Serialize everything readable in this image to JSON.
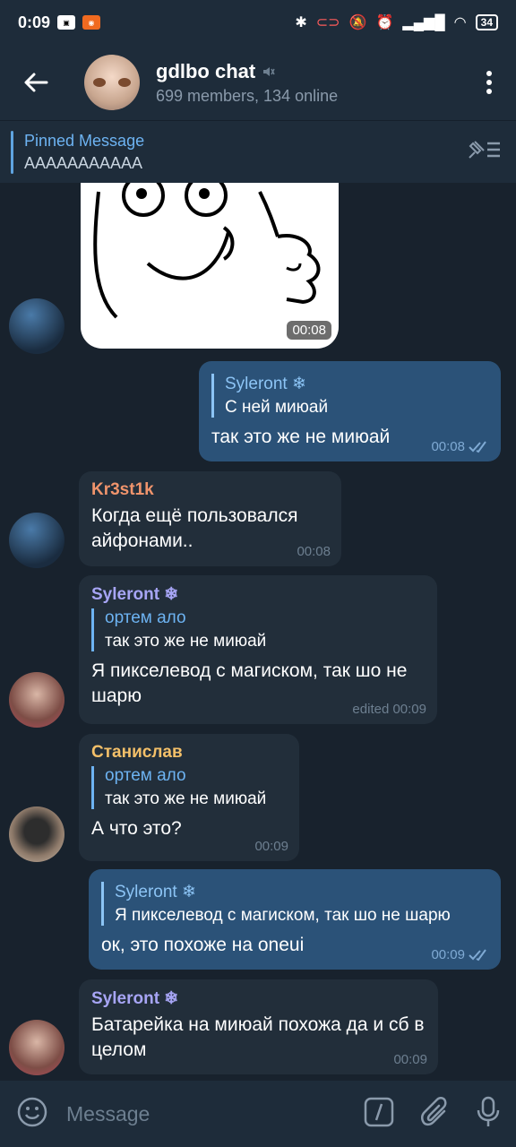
{
  "status": {
    "time": "0:09",
    "battery": "34"
  },
  "header": {
    "title": "gdlbo chat",
    "subtitle": "699 members, 134 online"
  },
  "pinned": {
    "title": "Pinned Message",
    "text": "AAAAAAAAAAA"
  },
  "messages": {
    "sticker_time": "00:08",
    "m1": {
      "reply_name": "Syleront ❄",
      "reply_text": "С ней миюай",
      "text": "так это же не миюай",
      "time": "00:08"
    },
    "m2": {
      "sender": "Kr3st1k",
      "text": "Когда ещё пользовался айфонами..",
      "time": "00:08"
    },
    "m3": {
      "sender": "Syleront ❄",
      "reply_name": "ортем ало",
      "reply_text": "так это же не миюай",
      "text": "Я пикселевод с магиском, так шо не шарю",
      "time": "edited 00:09"
    },
    "m4": {
      "sender": "Станислав",
      "reply_name": "ортем ало",
      "reply_text": "так это же не миюай",
      "text": "А что это?",
      "time": "00:09"
    },
    "m5": {
      "reply_name": "Syleront ❄",
      "reply_text": "Я пикселевод с магиском, так шо не шарю",
      "text": "ок, это похоже на oneui",
      "time": "00:09"
    },
    "m6": {
      "sender": "Syleront ❄",
      "text": "Батарейка на миюай похожа да и сб в целом",
      "time": "00:09"
    }
  },
  "input": {
    "placeholder": "Message"
  },
  "colors": {
    "kr3st1k": "#f0946c",
    "syleront": "#a7a5f5",
    "stanislav": "#f4c069"
  }
}
